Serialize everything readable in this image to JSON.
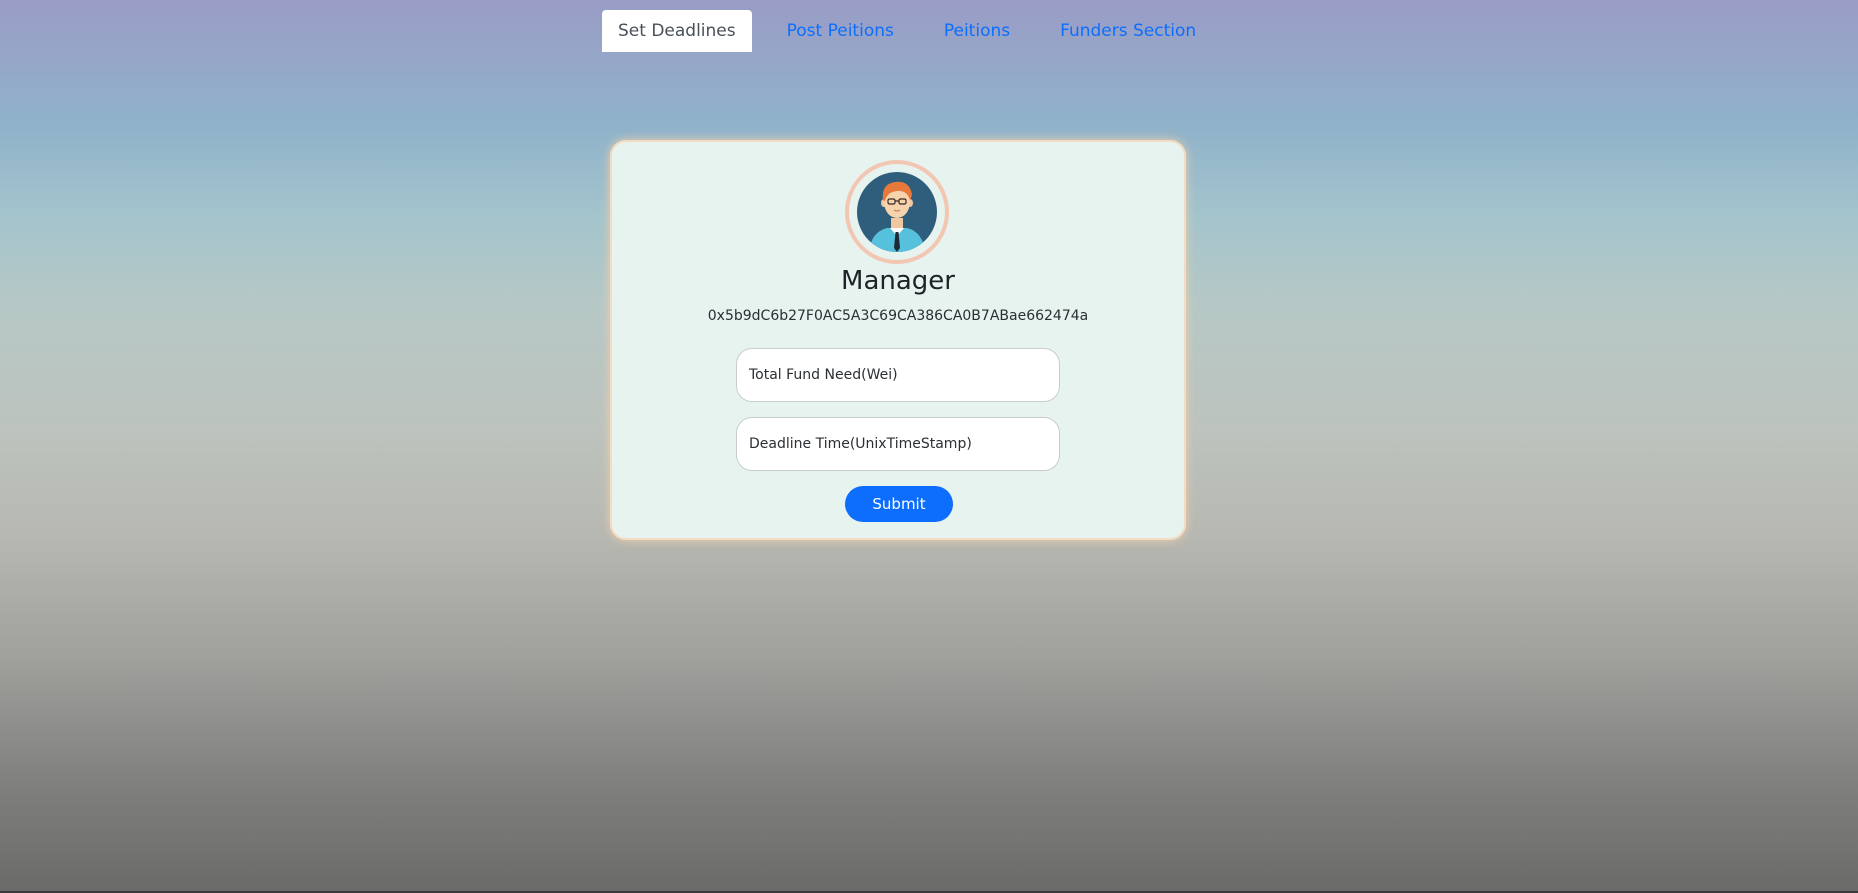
{
  "nav": {
    "tabs": [
      {
        "label": "Set Deadlines",
        "active": true
      },
      {
        "label": "Post Peitions",
        "active": false
      },
      {
        "label": "Peitions",
        "active": false
      },
      {
        "label": "Funders Section",
        "active": false
      }
    ]
  },
  "profile": {
    "avatar_icon": "manager-avatar-icon",
    "role": "Manager",
    "address": "0x5b9dC6b27F0AC5A3C69CA386CA0B7ABae662474a"
  },
  "form": {
    "fund_placeholder": "Total Fund Need(Wei)",
    "fund_value": "",
    "deadline_placeholder": "Deadline Time(UnixTimeStamp)",
    "deadline_value": "",
    "submit_label": "Submit"
  },
  "colors": {
    "accent": "#0d6efd",
    "card_bg": "#e6f3ef",
    "card_border": "#f4dcc4",
    "avatar_ring": "#f3c6b2"
  }
}
